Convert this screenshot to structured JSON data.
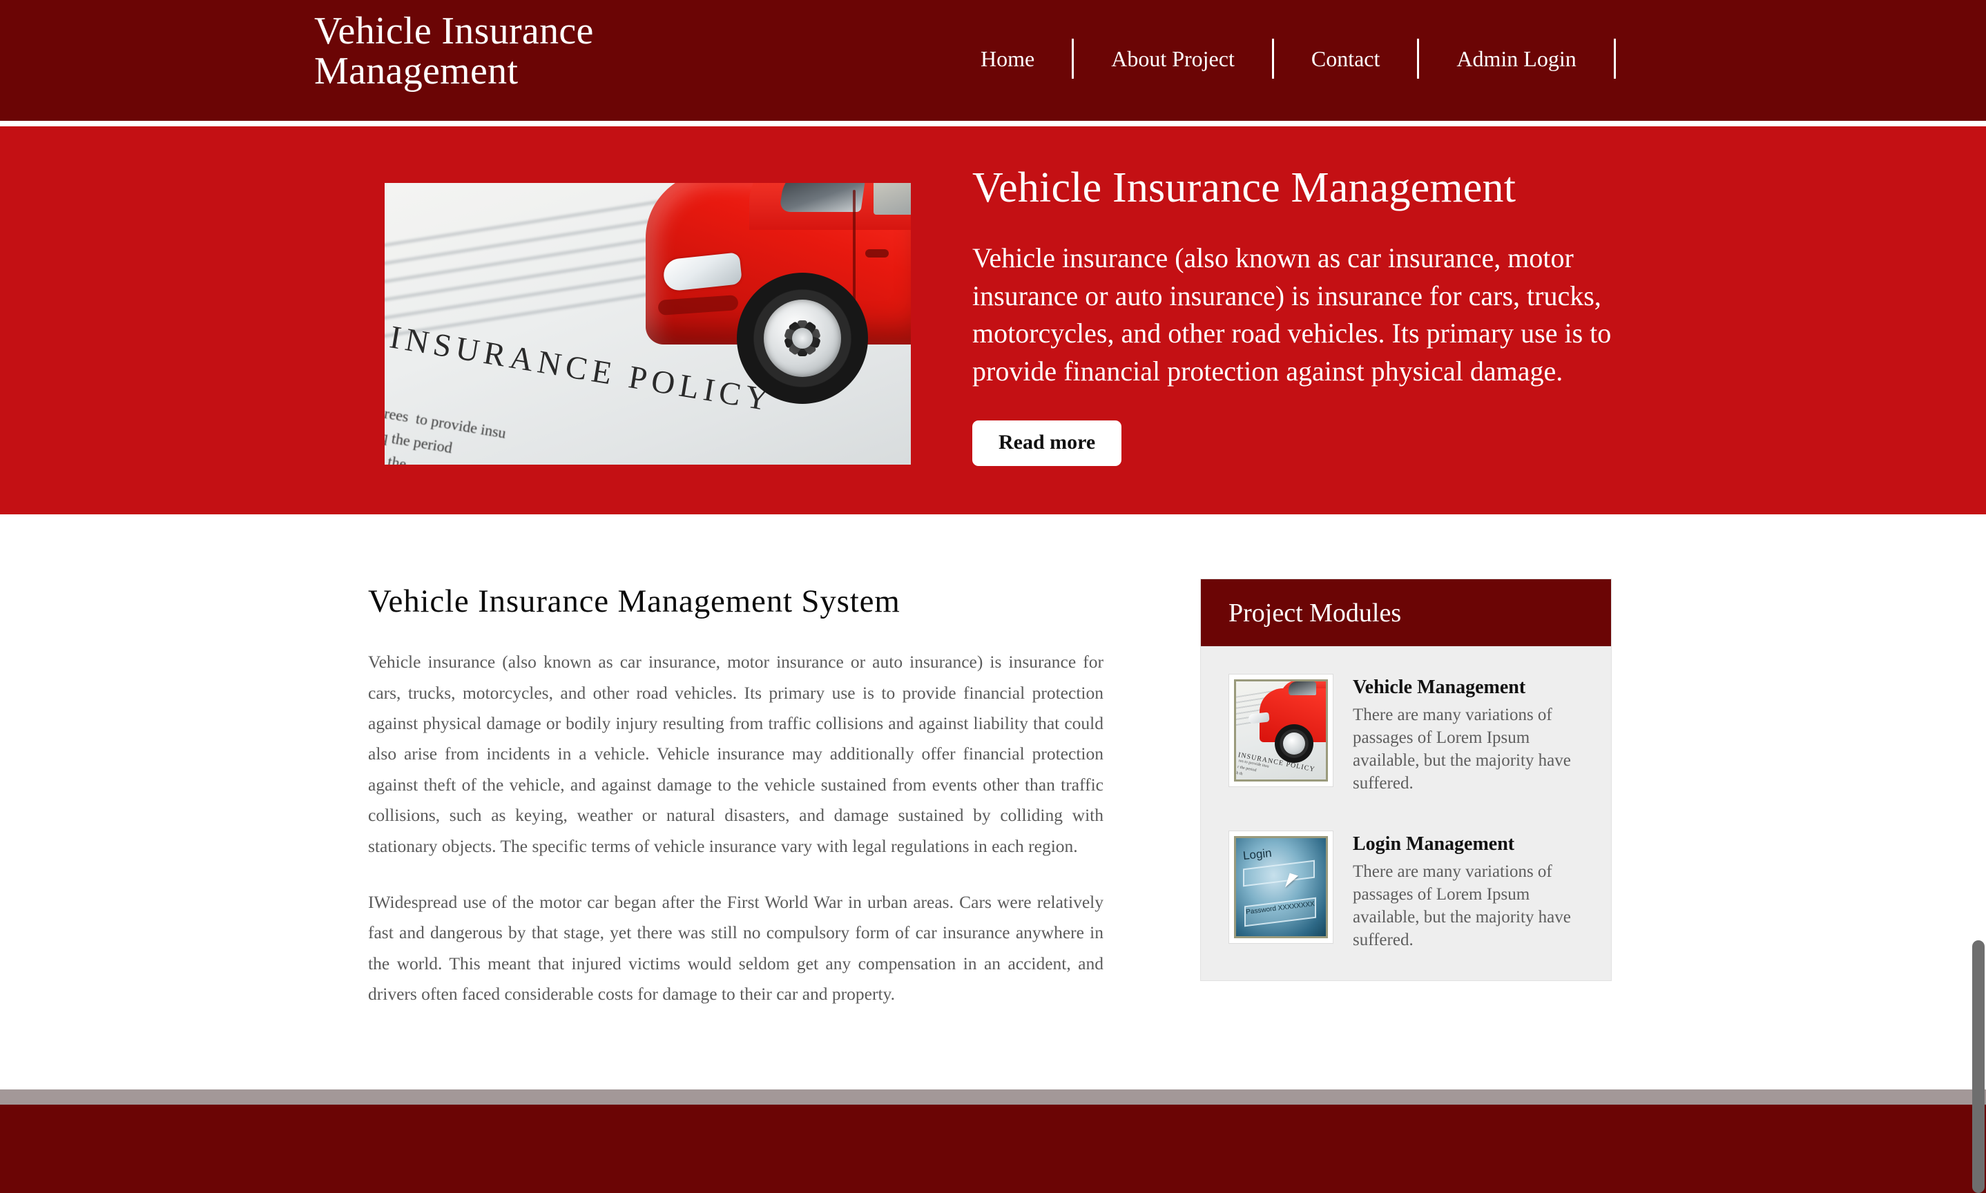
{
  "theme": {
    "header_maroon": "#6b0505",
    "hero_red": "#c41014",
    "sidebar_bg": "#eeeeee",
    "body_text": "#5b5b5b",
    "divider_gray": "#a39898"
  },
  "header": {
    "brand": "Vehicle Insurance Management",
    "nav": [
      {
        "label": "Home"
      },
      {
        "label": "About Project"
      },
      {
        "label": "Contact"
      },
      {
        "label": "Admin Login"
      }
    ]
  },
  "hero": {
    "image_alt": "insurance-policy-with-red-car",
    "image_caption_main": "INSURANCE POLICY",
    "image_caption_fine": "rees  to provide insu\nq the period\nh the",
    "title": "Vehicle Insurance Management",
    "description": "Vehicle insurance (also known as car insurance, motor insurance or auto insurance) is insurance for cars, trucks, motorcycles, and other road vehicles. Its primary use is to provide financial protection against physical damage.",
    "read_more_label": "Read more"
  },
  "article": {
    "title": "Vehicle Insurance Management System",
    "paragraphs": [
      "Vehicle insurance (also known as car insurance, motor insurance or auto insurance) is insurance for cars, trucks, motorcycles, and other road vehicles. Its primary use is to provide financial protection against physical damage or bodily injury resulting from traffic collisions and against liability that could also arise from incidents in a vehicle. Vehicle insurance may additionally offer financial protection against theft of the vehicle, and against damage to the vehicle sustained from events other than traffic collisions, such as keying, weather or natural disasters, and damage sustained by colliding with stationary objects. The specific terms of vehicle insurance vary with legal regulations in each region.",
      "IWidespread use of the motor car began after the First World War in urban areas. Cars were relatively fast and dangerous by that stage, yet there was still no compulsory form of car insurance anywhere in the world. This meant that injured victims would seldom get any compensation in an accident, and drivers often faced considerable costs for damage to their car and property."
    ]
  },
  "sidebar": {
    "title": "Project Modules",
    "modules": [
      {
        "title": "Vehicle Management",
        "description": "There are many variations of passages of Lorem Ipsum available, but the majority have suffered.",
        "thumb_alt": "red-car-on-insurance-policy-thumbnail",
        "thumb_caption": "INSURANCE POLICY",
        "thumb_fine": "res to provide insu\nr the period\nh th"
      },
      {
        "title": "Login Management",
        "description": "There are many variations of passages of Lorem Ipsum available, but the majority have suffered.",
        "thumb_alt": "login-screen-thumbnail",
        "thumb_label": "Login",
        "thumb_password": "Password XXXXXXXX"
      }
    ]
  }
}
